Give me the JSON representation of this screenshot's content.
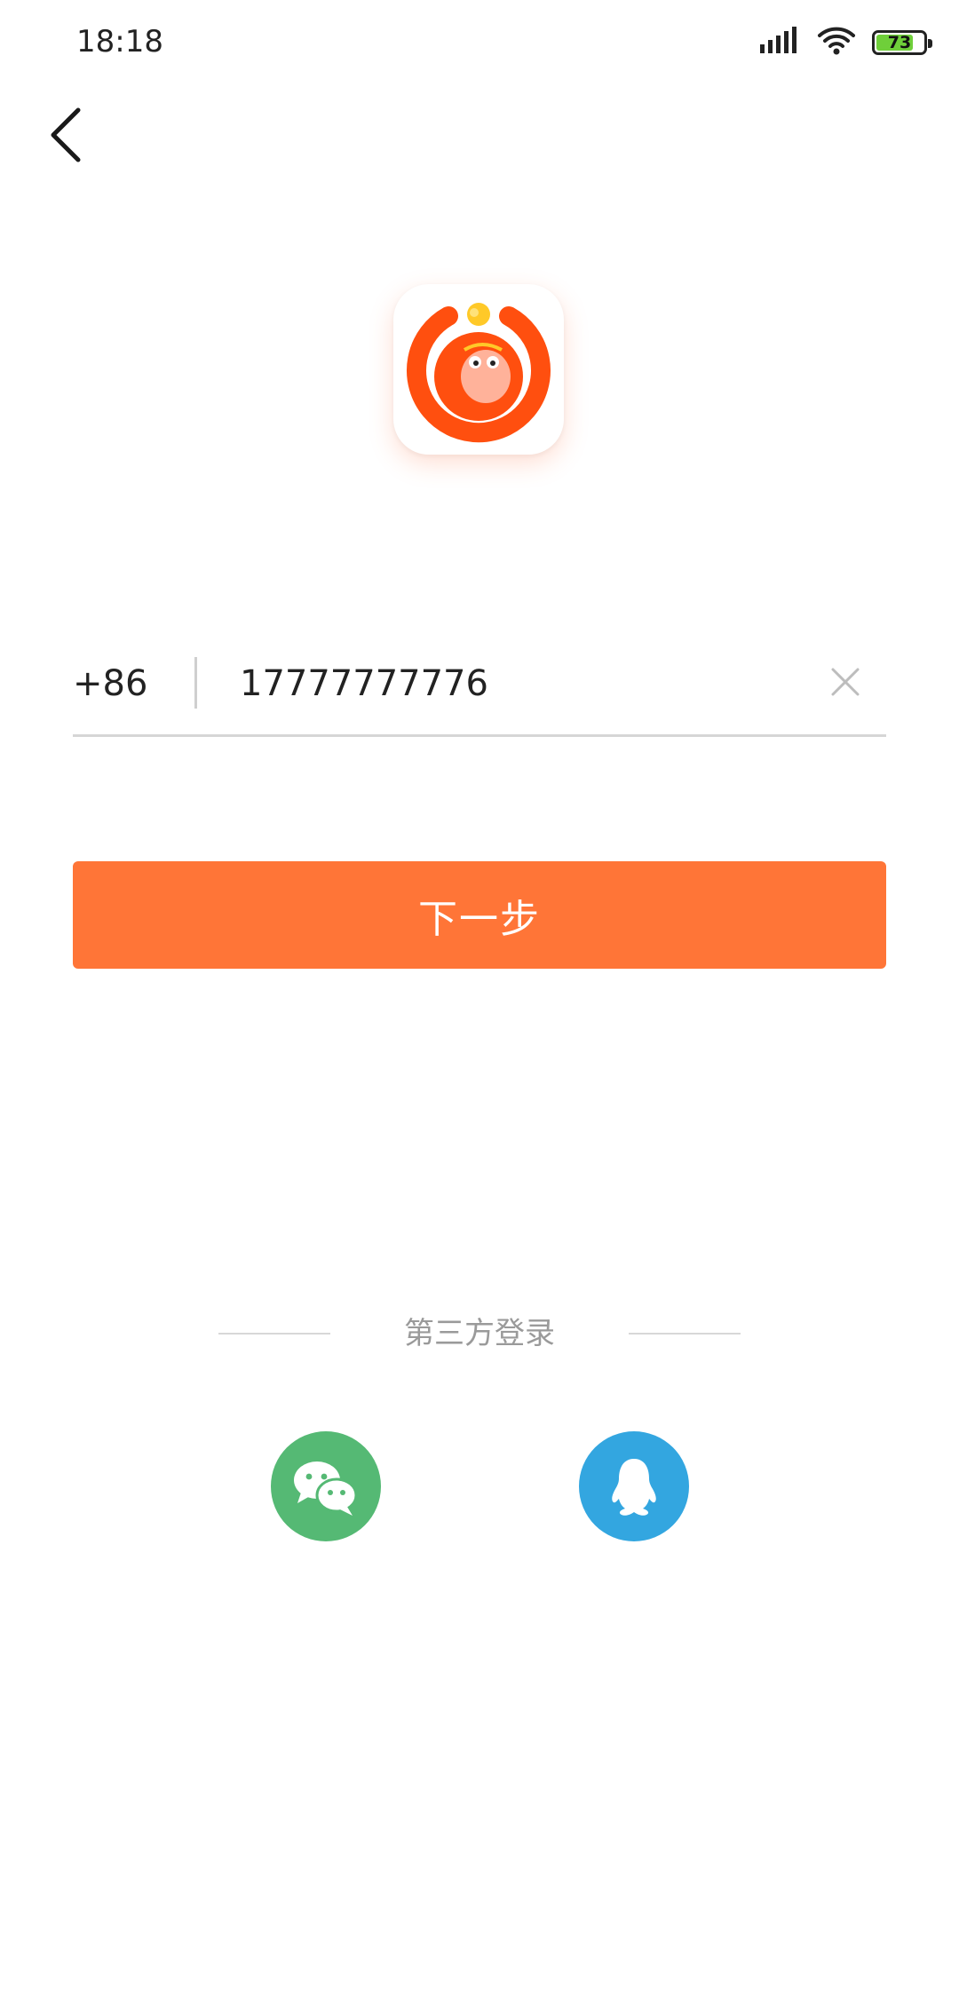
{
  "status_bar": {
    "time": "18:18",
    "battery_level": "73",
    "icons": [
      "signal-icon",
      "wifi-icon",
      "battery-icon"
    ]
  },
  "header": {
    "back_icon": "back-arrow-icon"
  },
  "logo": {
    "icon": "monkey-app-logo"
  },
  "phone": {
    "country_code": "+86",
    "value": "17777777776",
    "clear_icon": "clear-x-icon"
  },
  "next_button": {
    "label": "下一步"
  },
  "third_party": {
    "label": "第三方登录",
    "options": [
      {
        "icon": "wechat-icon"
      },
      {
        "icon": "qq-icon"
      }
    ]
  },
  "colors": {
    "accent": "#ff7537",
    "wechat": "#55b974",
    "qq": "#33a6e0",
    "logo_orange": "#ff4f0f",
    "logo_face": "#ffb29a",
    "logo_crown": "#ffc928"
  }
}
